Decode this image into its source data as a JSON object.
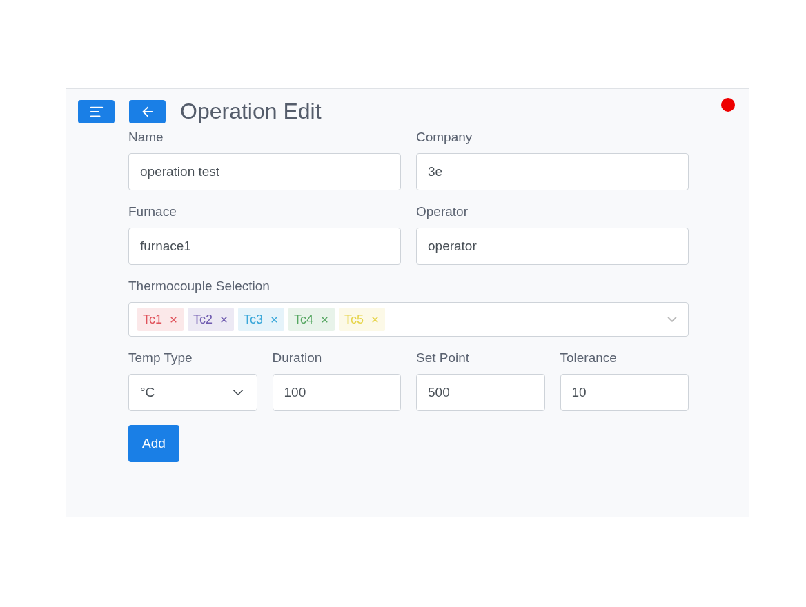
{
  "header": {
    "title": "Operation Edit"
  },
  "rows": [
    {
      "fields": [
        {
          "kind": "text",
          "label": "Name",
          "value": "operation test"
        },
        {
          "kind": "text",
          "label": "Company",
          "value": "3e"
        }
      ]
    },
    {
      "fields": [
        {
          "kind": "text",
          "label": "Furnace",
          "value": "furnace1"
        },
        {
          "kind": "text",
          "label": "Operator",
          "value": "operator"
        }
      ]
    },
    {
      "fields": [
        {
          "kind": "tags",
          "label": "Thermocouple Selection",
          "tags": [
            {
              "label": "Tc1",
              "color": "#e0525b"
            },
            {
              "label": "Tc2",
              "color": "#6f5bb0"
            },
            {
              "label": "Tc3",
              "color": "#3aa7d9"
            },
            {
              "label": "Tc4",
              "color": "#55a661"
            },
            {
              "label": "Tc5",
              "color": "#e6d44a"
            }
          ]
        }
      ]
    },
    {
      "fields": [
        {
          "kind": "select",
          "label": "Temp Type",
          "value": "°C"
        },
        {
          "kind": "text",
          "label": "Duration",
          "value": "100"
        },
        {
          "kind": "text",
          "label": "Set Point",
          "value": "500"
        },
        {
          "kind": "text",
          "label": "Tolerance",
          "value": "10"
        }
      ]
    }
  ],
  "buttons": [
    {
      "label": "Add"
    }
  ]
}
